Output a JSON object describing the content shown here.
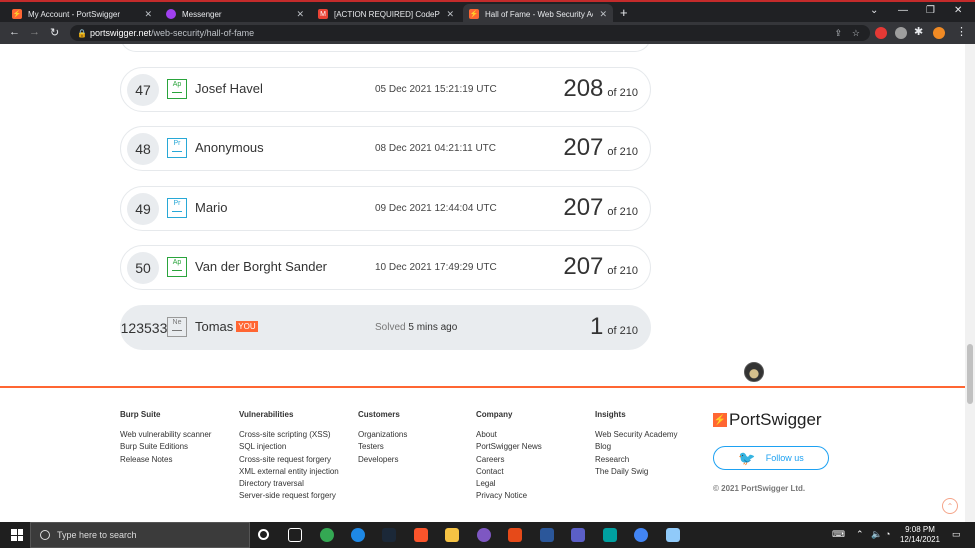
{
  "browser": {
    "tabs": [
      {
        "title": "My Account - PortSwigger",
        "favicon": "portswigger-icon",
        "color": "#ff6633"
      },
      {
        "title": "Messenger",
        "favicon": "messenger-icon",
        "color": "#a040f0"
      },
      {
        "title": "[ACTION REQUIRED] CodePath a",
        "favicon": "gmail-icon",
        "color": "#ea4335"
      },
      {
        "title": "Hall of Fame - Web Security Acad",
        "favicon": "portswigger-icon",
        "color": "#ff6633"
      }
    ],
    "new_tab": "+",
    "url_host": "portswigger.net",
    "url_path": "/web-security/hall-of-fame"
  },
  "leaderboard": [
    {
      "rank": "47",
      "level": "Ap",
      "level_color": "#2aa43c",
      "name": "Josef Havel",
      "date": "05 Dec 2021 15:21:19 UTC",
      "score": "208",
      "of": "of 210"
    },
    {
      "rank": "48",
      "level": "Pr",
      "level_color": "#28a8d6",
      "name": "Anonymous",
      "date": "08 Dec 2021 04:21:11 UTC",
      "score": "207",
      "of": "of 210"
    },
    {
      "rank": "49",
      "level": "Pr",
      "level_color": "#28a8d6",
      "name": "Mario",
      "date": "09 Dec 2021 12:44:04 UTC",
      "score": "207",
      "of": "of 210"
    },
    {
      "rank": "50",
      "level": "Ap",
      "level_color": "#2aa43c",
      "name": "Van der Borght Sander",
      "date": "10 Dec 2021 17:49:29 UTC",
      "score": "207",
      "of": "of 210"
    }
  ],
  "current_user": {
    "rank": "123533",
    "level": "Ne",
    "name": "Tomas",
    "badge": "YOU",
    "solved_prefix": "Solved",
    "solved_time": "5 mins ago",
    "score": "1",
    "of": "of 210"
  },
  "footer": {
    "columns": [
      {
        "title": "Burp Suite",
        "links": [
          "Web vulnerability scanner",
          "Burp Suite Editions",
          "Release Notes"
        ]
      },
      {
        "title": "Vulnerabilities",
        "links": [
          "Cross-site scripting (XSS)",
          "SQL injection",
          "Cross-site request forgery",
          "XML external entity injection",
          "Directory traversal",
          "Server-side request forgery"
        ]
      },
      {
        "title": "Customers",
        "links": [
          "Organizations",
          "Testers",
          "Developers"
        ]
      },
      {
        "title": "Company",
        "links": [
          "About",
          "PortSwigger News",
          "Careers",
          "Contact",
          "Legal",
          "Privacy Notice"
        ]
      },
      {
        "title": "Insights",
        "links": [
          "Web Security Academy",
          "Blog",
          "Research",
          "The Daily Swig"
        ]
      }
    ],
    "brand": "PortSwigger",
    "follow_label": "Follow us",
    "copyright": "© 2021 PortSwigger Ltd.",
    "accent": "#ff6633"
  },
  "taskbar": {
    "search_placeholder": "Type here to search",
    "time": "9:08 PM",
    "date": "12/14/2021"
  }
}
